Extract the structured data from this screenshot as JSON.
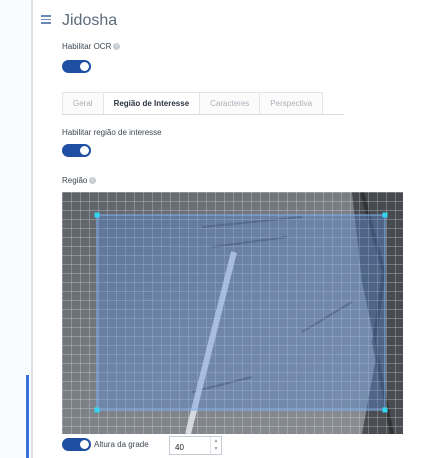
{
  "panel": {
    "title": "Jidosha",
    "menu_icon": "list-icon"
  },
  "ocr": {
    "label": "Habilitar OCR",
    "info_icon": "info-icon",
    "enabled": true
  },
  "tabs": [
    {
      "label": "Geral",
      "active": false
    },
    {
      "label": "Região de Interesse",
      "active": true
    },
    {
      "label": "Caracteres",
      "active": false
    },
    {
      "label": "Perspectiva",
      "active": false
    }
  ],
  "roi": {
    "label": "Habilitar região de interesse",
    "enabled": true
  },
  "region": {
    "label": "Região",
    "info_icon": "info-icon"
  },
  "grid": {
    "toggle_enabled": true,
    "height_label": "Altura da grade",
    "height_value": "40"
  },
  "colors": {
    "toggle_on": "#1f4fa3",
    "selection_fill": "#5b8fe0",
    "handle": "#33d6f0",
    "accent_marker": "#3a6fd8"
  }
}
